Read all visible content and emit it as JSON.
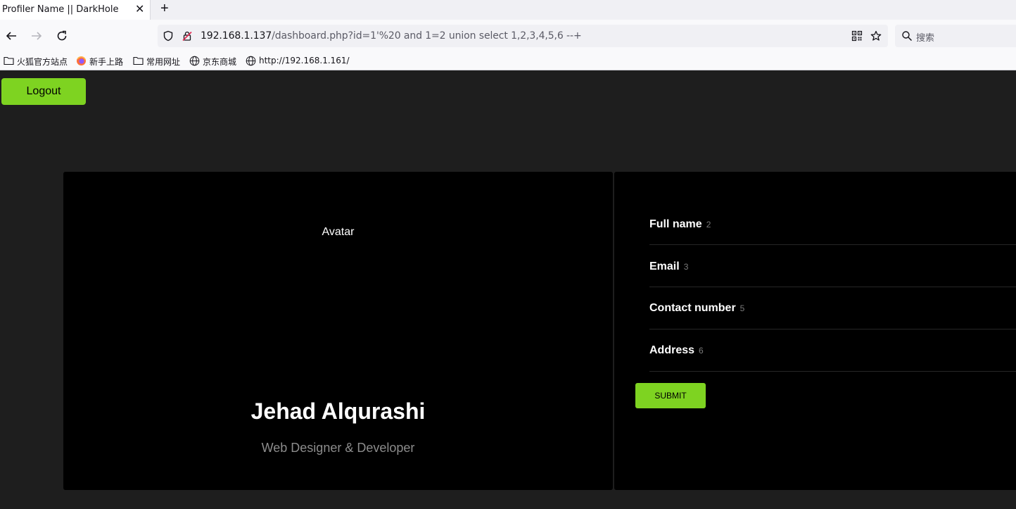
{
  "browser": {
    "tab_title": "Profiler Name || DarkHole",
    "tab_close": "✕",
    "new_tab": "+",
    "url_host": "192.168.1.137",
    "url_path": "/dashboard.php?id=1'%20 and 1=2 union select 1,2,3,4,5,6 --+",
    "search_placeholder": "搜索",
    "bookmarks": [
      {
        "label": "火狐官方站点",
        "icon": "folder-icon"
      },
      {
        "label": "新手上路",
        "icon": "firefox-icon"
      },
      {
        "label": "常用网址",
        "icon": "folder-icon"
      },
      {
        "label": "京东商城",
        "icon": "globe-icon"
      },
      {
        "label": "http://192.168.1.161/",
        "icon": "globe-icon"
      }
    ]
  },
  "page": {
    "logout_label": "Logout",
    "avatar_label": "Avatar",
    "name": "Jehad Alqurashi",
    "role": "Web Designer & Developer",
    "fields": [
      {
        "label": "Full name",
        "value": "2"
      },
      {
        "label": "Email",
        "value": "3"
      },
      {
        "label": "Contact number",
        "value": "5"
      },
      {
        "label": "Address",
        "value": "6"
      }
    ],
    "submit_label": "SUBMIT",
    "accent_color": "#7ed321"
  }
}
